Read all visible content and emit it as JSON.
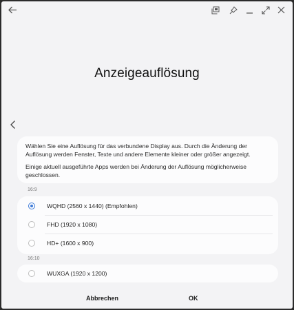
{
  "window": {
    "title": "Anzeigeauflösung",
    "icons": {
      "back": "arrow-left-icon",
      "screenshot": "screenshot-icon",
      "pin": "pin-icon",
      "minimize": "minimize-icon",
      "expand": "expand-icon",
      "close": "close-icon"
    }
  },
  "content": {
    "info_paragraph_1": "Wählen Sie eine Auflösung für das verbundene Display aus. Durch die Änderung der Auflösung werden Fenster, Texte und andere Elemente kleiner oder größer angezeigt.",
    "info_paragraph_2": "Einige aktuell ausgeführte Apps werden bei Änderung der Auflösung möglicherweise geschlossen.",
    "sections": [
      {
        "label": "16:9",
        "options": [
          {
            "label": "WQHD (2560 x 1440) (Empfohlen)",
            "selected": true
          },
          {
            "label": "FHD (1920 x 1080)",
            "selected": false
          },
          {
            "label": "HD+ (1600 x 900)",
            "selected": false
          }
        ]
      },
      {
        "label": "16:10",
        "options": [
          {
            "label": "WUXGA (1920 x 1200)",
            "selected": false
          }
        ]
      }
    ]
  },
  "footer": {
    "cancel_label": "Abbrechen",
    "ok_label": "OK"
  },
  "colors": {
    "accent": "#3e7bd8",
    "background": "#f3f3f5",
    "card": "#fcfcfd"
  }
}
